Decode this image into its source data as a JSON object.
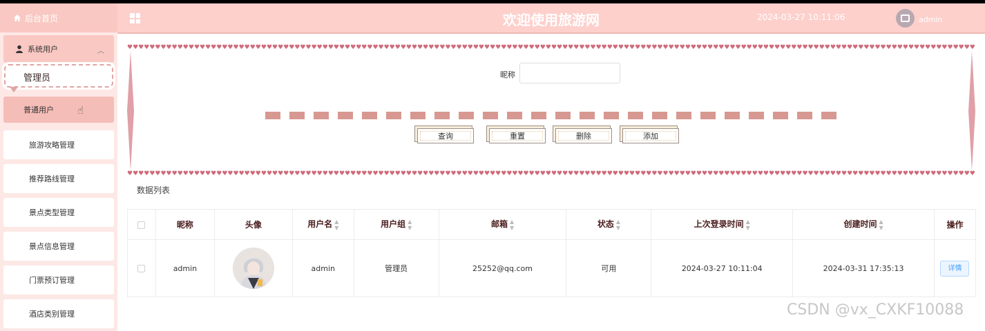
{
  "sidebar": {
    "home_label": "后台首页",
    "group_label": "系统用户",
    "sub_items": [
      "管理员",
      "普通用户"
    ],
    "items": [
      "旅游攻略管理",
      "推荐路线管理",
      "景点类型管理",
      "景点信息管理",
      "门票预订管理",
      "酒店类别管理"
    ]
  },
  "header": {
    "title": "欢迎使用旅游网",
    "datetime": "2024-03-27 10:11:06",
    "username": "admin"
  },
  "search": {
    "nickname_label": "昵称",
    "nickname_value": "",
    "buttons": [
      "查询",
      "重置",
      "删除",
      "添加"
    ]
  },
  "list_title": "数据列表",
  "table": {
    "columns": [
      "昵称",
      "头像",
      "用户名",
      "用户组",
      "邮箱",
      "状态",
      "上次登录时间",
      "创建时间",
      "操作"
    ],
    "rows": [
      {
        "nickname": "admin",
        "username": "admin",
        "group": "管理员",
        "email": "25252@qq.com",
        "status": "可用",
        "last_login": "2024-03-27 10:11:04",
        "created": "2024-03-31 17:35:13",
        "action": "详情"
      }
    ]
  },
  "watermark": "CSDN @vx_CXKF10088",
  "colors": {
    "header_bg": "#fdd0cc",
    "sidebar_bg": "#fde8e6",
    "accent": "#cf6b7b"
  }
}
